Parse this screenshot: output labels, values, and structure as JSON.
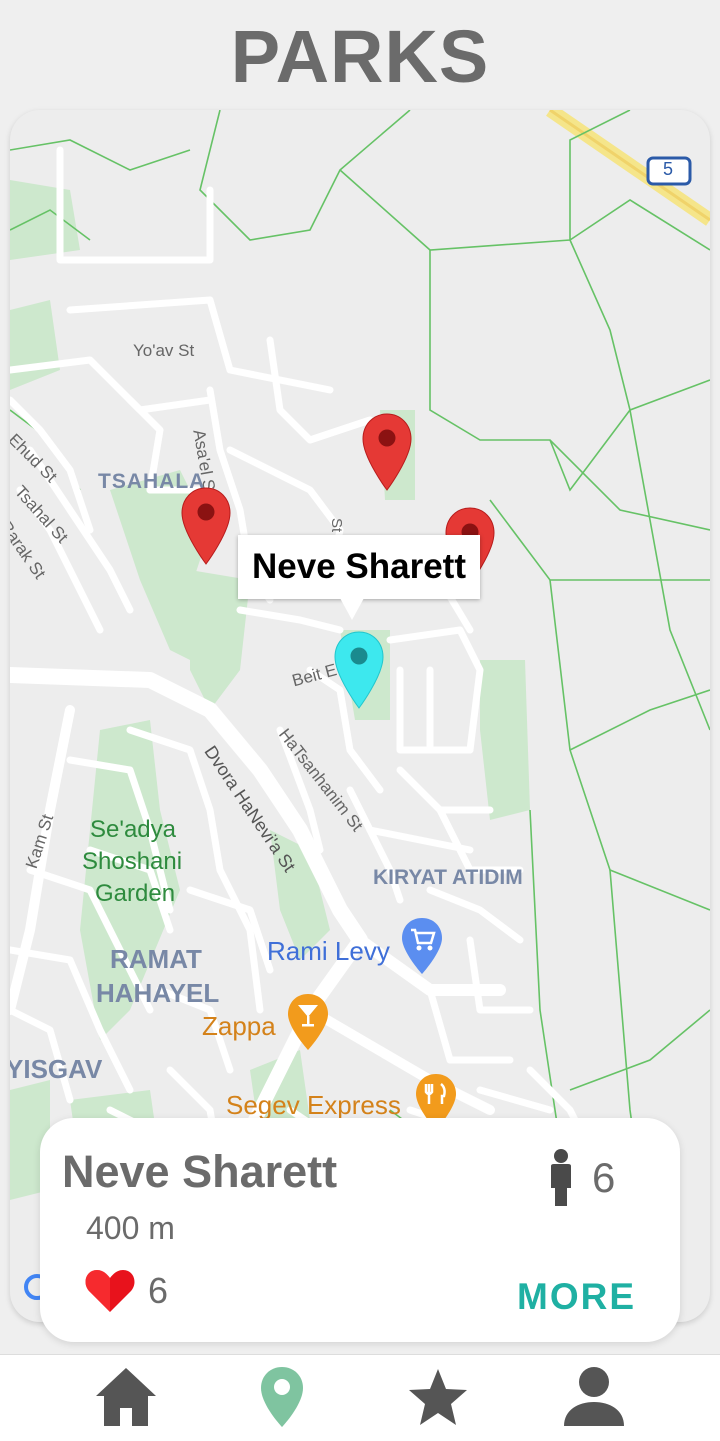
{
  "header": {
    "title": "PARKS"
  },
  "map": {
    "labels": {
      "yoav": "Yo'av St",
      "asael": "Asa'el St",
      "ehud": "Ehud St",
      "tsahal": "Tsahal St",
      "barak": "Barak St",
      "tsahala": "TSAHALA",
      "beit": "Beit E",
      "hatsanhanim": "HaTsanhanim St",
      "dvora": "Dvora HaNevi'a St",
      "kam": "Kam St",
      "seadya1": "Se'adya",
      "seadya2": "Shoshani",
      "seadya3": "Garden",
      "kiryat": "KIRYAT ATIDIM",
      "ramat1": "RAMAT",
      "ramat2": "HAHAYEL",
      "ramilevy": "Rami Levy",
      "zappa": "Zappa",
      "segev": "Segev Express",
      "yisgav": "YISGAV",
      "highway": "5",
      "street_st": "St"
    },
    "popup": "Neve Sharett",
    "colors": {
      "pin_red": "#e53935",
      "pin_selected": "#3de8ee",
      "park_green": "#cde8cd",
      "accent": "#1fb0a3"
    }
  },
  "card": {
    "name": "Neve Sharett",
    "distance": "400 m",
    "people": "6",
    "likes": "6",
    "more": "MORE"
  },
  "nav": {
    "items": [
      "home-icon",
      "map-pin-icon",
      "star-icon",
      "person-icon"
    ]
  }
}
